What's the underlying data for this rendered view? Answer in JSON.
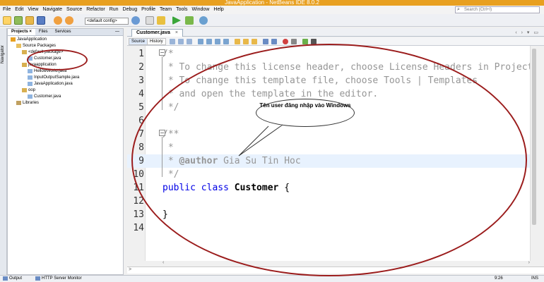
{
  "window": {
    "title": "JavaApplication - NetBeans IDE 8.0.2"
  },
  "menu": [
    "File",
    "Edit",
    "View",
    "Navigate",
    "Source",
    "Refactor",
    "Run",
    "Debug",
    "Profile",
    "Team",
    "Tools",
    "Window",
    "Help"
  ],
  "search": {
    "placeholder": "Search (Ctrl+I)"
  },
  "toolbar": {
    "config": "<default config>"
  },
  "sidebar": {
    "navigator_label": "Navigator"
  },
  "project_panel": {
    "tabs": [
      "Projects",
      "Files",
      "Services"
    ],
    "tab_close": "×",
    "panel_close": "—",
    "tree": [
      {
        "label": "JavaApplication",
        "depth": 0,
        "icon": "project-icon"
      },
      {
        "label": "Source Packages",
        "depth": 1,
        "icon": "folder-icon"
      },
      {
        "label": "<default package>",
        "depth": 2,
        "icon": "package-icon"
      },
      {
        "label": "Customer.java",
        "depth": 3,
        "icon": "java-file-icon"
      },
      {
        "label": "javaapplication",
        "depth": 2,
        "icon": "package-icon"
      },
      {
        "label": "HellowWorld.java",
        "depth": 3,
        "icon": "java-file-icon"
      },
      {
        "label": "InputOutputSample.java",
        "depth": 3,
        "icon": "java-file-icon"
      },
      {
        "label": "JavaApplication.java",
        "depth": 3,
        "icon": "java-file-icon"
      },
      {
        "label": "oop",
        "depth": 2,
        "icon": "package-icon"
      },
      {
        "label": "Customer.java",
        "depth": 3,
        "icon": "java-file-icon"
      },
      {
        "label": "Libraries",
        "depth": 1,
        "icon": "library-icon"
      }
    ]
  },
  "editor": {
    "tab_label": "Customer.java",
    "tab_close": "×",
    "tab_nav": "‹ › ▾ ▭",
    "toolbar": {
      "source": "Source",
      "history": "History"
    },
    "lines": [
      {
        "n": "1",
        "text": "/*"
      },
      {
        "n": "2",
        "text": " * To change this license header, choose License Headers in Project Properties."
      },
      {
        "n": "3",
        "text": " * To change this template file, choose Tools | Templates"
      },
      {
        "n": "4",
        "text": " * and open the template in the editor."
      },
      {
        "n": "5",
        "text": " */"
      },
      {
        "n": "6",
        "text": ""
      },
      {
        "n": "7",
        "text": "/**"
      },
      {
        "n": "8",
        "text": " *"
      },
      {
        "n": "9",
        "text": " * @author Gia Su Tin Hoc"
      },
      {
        "n": "10",
        "text": " */"
      },
      {
        "n": "11",
        "text": "public class Customer {"
      },
      {
        "n": "12",
        "text": ""
      },
      {
        "n": "13",
        "text": "}"
      },
      {
        "n": "14",
        "text": ""
      }
    ],
    "code": {
      "c1": "/*",
      "c2": " * To change this license header, choose License Headers in Project Properties.",
      "c3": " * To change this template file, choose Tools | Templates",
      "c4": " * and open the template in the editor.",
      "c5": " */",
      "c7": "/**",
      "c8": " *",
      "c9_pre": " * ",
      "c9_tag": "@author",
      "c9_val": " Gia Su Tin Hoc",
      "c10": " */",
      "c11_kw": "public class ",
      "c11_name": "Customer",
      "c11_rest": " {",
      "c13": "}"
    }
  },
  "annotation": {
    "callout": "Tên user đăng nhập vào Windows"
  },
  "status": {
    "output": "Output",
    "http_monitor": "HTTP Server Monitor",
    "position": "9:26",
    "mode": "INS"
  },
  "colors": {
    "accent": "#e8a020",
    "annotation": "#9b1c1c",
    "keyword": "#0000e6",
    "comment": "#969696"
  }
}
